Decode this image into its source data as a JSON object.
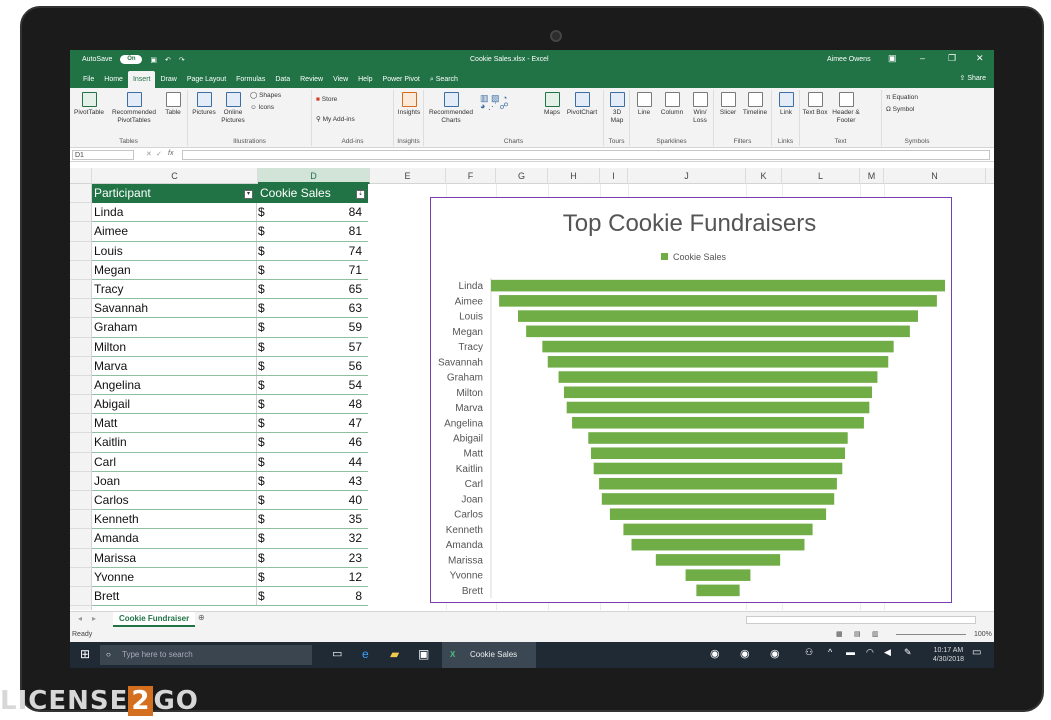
{
  "titlebar": {
    "autosave_label": "AutoSave",
    "autosave_state": "On",
    "file_title": "Cookie Sales.xlsx - Excel",
    "user": "Aimee Owens"
  },
  "tabs": [
    {
      "label": "File"
    },
    {
      "label": "Home"
    },
    {
      "label": "Insert",
      "active": true
    },
    {
      "label": "Draw"
    },
    {
      "label": "Page Layout"
    },
    {
      "label": "Formulas"
    },
    {
      "label": "Data"
    },
    {
      "label": "Review"
    },
    {
      "label": "View"
    },
    {
      "label": "Help"
    },
    {
      "label": "Power Pivot"
    },
    {
      "label": "Search"
    }
  ],
  "share_label": "Share",
  "ribbon": {
    "tables": {
      "group": "Tables",
      "pivot": "PivotTable",
      "recommended": "Recommended PivotTables",
      "table": "Table"
    },
    "illustrations": {
      "group": "Illustrations",
      "pictures": "Pictures",
      "online": "Online Pictures",
      "shapes": "Shapes",
      "icons": "Icons"
    },
    "addins": {
      "group": "Add-ins",
      "store": "Store",
      "my": "My Add-ins"
    },
    "insights": {
      "group": "Insights",
      "label": "Insights"
    },
    "charts": {
      "group": "Charts",
      "recommended": "Recommended Charts",
      "maps": "Maps",
      "pivotchart": "PivotChart"
    },
    "tours": {
      "group": "Tours",
      "map3d": "3D Map"
    },
    "sparklines": {
      "group": "Sparklines",
      "line": "Line",
      "column": "Column",
      "winloss": "Win/ Loss"
    },
    "filters": {
      "group": "Filters",
      "slicer": "Slicer",
      "timeline": "Timeline"
    },
    "links": {
      "group": "Links",
      "link": "Link"
    },
    "text": {
      "group": "Text",
      "textbox": "Text Box",
      "header": "Header & Footer"
    },
    "symbols": {
      "group": "Symbols",
      "equation": "Equation",
      "symbol": "Symbol"
    }
  },
  "formula_bar": {
    "name_box": "D1",
    "fx": "fx"
  },
  "columns": [
    "C",
    "D",
    "E",
    "F",
    "G",
    "H",
    "I",
    "J",
    "K",
    "L",
    "M",
    "N"
  ],
  "table": {
    "header_participant": "Participant",
    "header_sales": "Cookie Sales",
    "currency": "$",
    "rows": [
      {
        "name": "Linda",
        "value": "84"
      },
      {
        "name": "Aimee",
        "value": "81"
      },
      {
        "name": "Louis",
        "value": "74"
      },
      {
        "name": "Megan",
        "value": "71"
      },
      {
        "name": "Tracy",
        "value": "65"
      },
      {
        "name": "Savannah",
        "value": "63"
      },
      {
        "name": "Graham",
        "value": "59"
      },
      {
        "name": "Milton",
        "value": "57"
      },
      {
        "name": "Marva",
        "value": "56"
      },
      {
        "name": "Angelina",
        "value": "54"
      },
      {
        "name": "Abigail",
        "value": "48"
      },
      {
        "name": "Matt",
        "value": "47"
      },
      {
        "name": "Kaitlin",
        "value": "46"
      },
      {
        "name": "Carl",
        "value": "44"
      },
      {
        "name": "Joan",
        "value": "43"
      },
      {
        "name": "Carlos",
        "value": "40"
      },
      {
        "name": "Kenneth",
        "value": "35"
      },
      {
        "name": "Amanda",
        "value": "32"
      },
      {
        "name": "Marissa",
        "value": "23"
      },
      {
        "name": "Yvonne",
        "value": "12"
      },
      {
        "name": "Brett",
        "value": "8"
      }
    ]
  },
  "chart_data": {
    "type": "bar",
    "orientation": "horizontal-funnel",
    "title": "Top Cookie Fundraisers",
    "legend": "top",
    "series": [
      {
        "name": "Cookie Sales",
        "color": "#70ad47",
        "values": [
          84,
          81,
          74,
          71,
          65,
          63,
          59,
          57,
          56,
          54,
          48,
          47,
          46,
          44,
          43,
          40,
          35,
          32,
          23,
          12,
          8
        ]
      }
    ],
    "categories": [
      "Linda",
      "Aimee",
      "Louis",
      "Megan",
      "Tracy",
      "Savannah",
      "Graham",
      "Milton",
      "Marva",
      "Angelina",
      "Abigail",
      "Matt",
      "Kaitlin",
      "Carl",
      "Joan",
      "Carlos",
      "Kenneth",
      "Amanda",
      "Marissa",
      "Yvonne",
      "Brett"
    ],
    "grid": false
  },
  "sheet_tab": "Cookie Fundraiser",
  "status": {
    "ready": "Ready",
    "zoom": "100%"
  },
  "taskbar": {
    "search_placeholder": "Type here to search",
    "app_label": "Cookie Sales",
    "time": "10:17 AM",
    "date": "4/30/2018"
  },
  "colors": {
    "excel_green": "#217346",
    "bar_green": "#70ad47",
    "chart_border": "#7a3fae"
  }
}
